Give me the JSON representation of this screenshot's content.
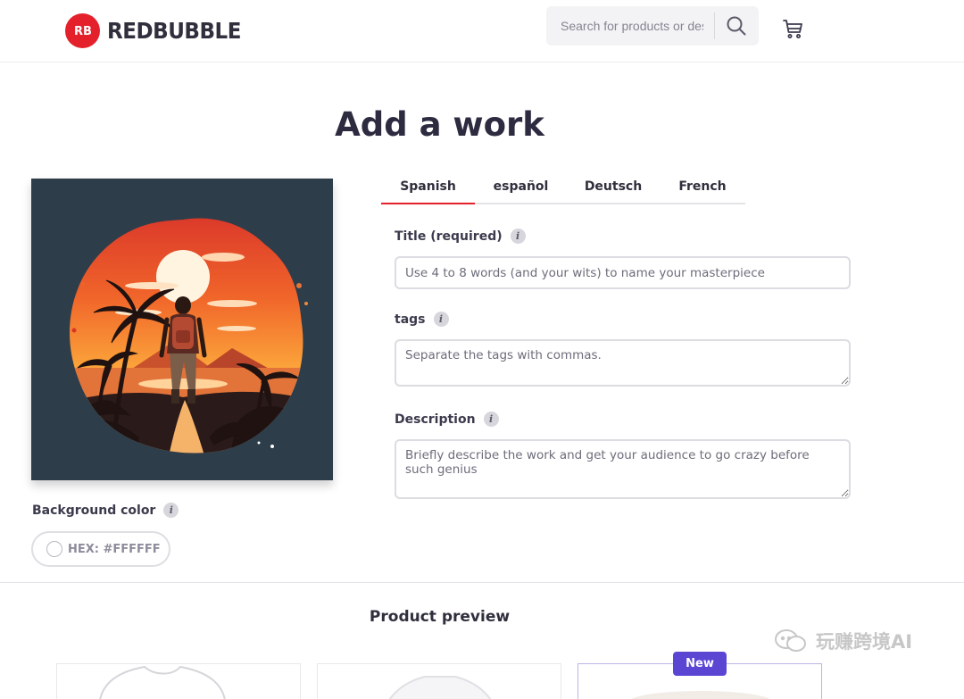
{
  "header": {
    "logo_text": "REDBUBBLE",
    "logo_mark": "RB",
    "search": {
      "placeholder": "Search for products or designs",
      "icon": "search-icon"
    },
    "cart_icon": "cart-icon"
  },
  "page_title": "Add a work",
  "artwork": {
    "background_color": "#2e3d4a"
  },
  "background_color": {
    "label": "Background color",
    "hex_value": "HEX: #FFFFFF",
    "info_glyph": "i"
  },
  "tabs": [
    {
      "label": "Spanish",
      "active": true
    },
    {
      "label": "español",
      "active": false
    },
    {
      "label": "Deutsch",
      "active": false
    },
    {
      "label": "French",
      "active": false
    }
  ],
  "form": {
    "title": {
      "label": "Title (required)",
      "placeholder": "Use 4 to 8 words (and your wits) to name your masterpiece"
    },
    "tags": {
      "label": "tags",
      "placeholder": "Separate the tags with commas."
    },
    "description": {
      "label": "Description",
      "placeholder": "Briefly describe the work and get your audience to go crazy before such genius"
    }
  },
  "product_preview": {
    "title": "Product preview",
    "new_badge": "New"
  },
  "watermark": "玩赚跨境AI",
  "colors": {
    "brand_red": "#e4202b",
    "new_badge_purple": "#5b46d4",
    "heading": "#2c2b40"
  }
}
